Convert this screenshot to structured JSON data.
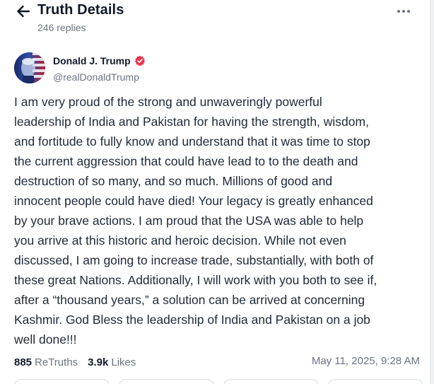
{
  "header": {
    "title": "Truth Details",
    "replies": "246 replies",
    "back_icon": "arrow-left-icon",
    "more_icon": "more-horizontal-icon"
  },
  "author": {
    "name": "Donald J. Trump",
    "handle": "@realDonaldTrump",
    "verified_icon": "verified-badge-icon",
    "verified_color": "#e8344a"
  },
  "post": {
    "text": "I am very proud of the strong and unwaveringly powerful\nleadership of India and Pakistan for having the strength, wisdom,\nand fortitude to fully know and understand that it was time to stop\nthe current aggression that could have lead to to the death and\ndestruction of so many, and so much. Millions of good and\ninnocent people could have died! Your legacy is greatly enhanced\nby your brave actions. I am proud that the USA was able to help\nyou arrive at this historic and heroic decision. While not even\ndiscussed, I am going to increase trade, substantially, with both of\nthese great Nations. Additionally, I will work with you both to see if,\nafter a “thousand years,” a solution can be arrived at concerning\nKashmir. God Bless the leadership of India and Pakistan on a job\nwell done!!!"
  },
  "stats": {
    "retruths_count": "885",
    "retruths_label": "ReTruths",
    "likes_count": "3.9k",
    "likes_label": "Likes",
    "timestamp": "May 11, 2025, 9:28 AM"
  },
  "colors": {
    "text_primary": "#111827",
    "text_secondary": "#6b7280",
    "accent": "#e8344a"
  }
}
